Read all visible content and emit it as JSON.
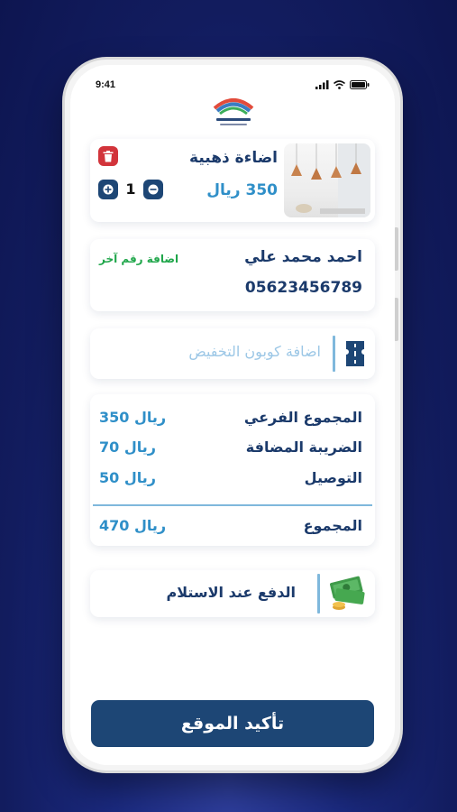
{
  "status_bar": {
    "time": "9:41"
  },
  "product": {
    "name": "اضاءة ذهبية",
    "price": "350 ريال",
    "quantity": "1",
    "image_icon": "pendant-lamps-image"
  },
  "contact": {
    "name": "احمد محمد علي",
    "phone": "05623456789",
    "add_number_label": "اضافة رقم آخر"
  },
  "coupon": {
    "placeholder": "اضافة كوبون التخفيض",
    "icon": "coupon-ticket-icon"
  },
  "summary": {
    "subtotal_label": "المجموع الفرعي",
    "subtotal_value": "350 ريال",
    "tax_label": "الضريبة المضافة",
    "tax_value": "70 ريال",
    "delivery_label": "التوصيل",
    "delivery_value": "50 ريال",
    "total_label": "المجموع",
    "total_value": "470 ريال"
  },
  "payment": {
    "label": "الدفع عند الاستلام",
    "icon": "cash-money-icon"
  },
  "confirm_button": {
    "label": "تأكيد الموقع"
  },
  "colors": {
    "navy": "#1b3a6b",
    "teal": "#2f8fc8",
    "green": "#1fa64a",
    "red": "#d2343b",
    "button": "#1d4675"
  }
}
